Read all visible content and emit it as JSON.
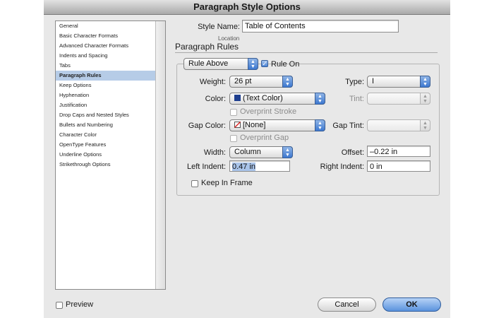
{
  "window": {
    "title": "Paragraph Style Options"
  },
  "sidebar": {
    "items": [
      {
        "label": "General"
      },
      {
        "label": "Basic Character Formats"
      },
      {
        "label": "Advanced Character Formats"
      },
      {
        "label": "Indents and Spacing"
      },
      {
        "label": "Tabs"
      },
      {
        "label": "Paragraph Rules"
      },
      {
        "label": "Keep Options"
      },
      {
        "label": "Hyphenation"
      },
      {
        "label": "Justification"
      },
      {
        "label": "Drop Caps and Nested Styles"
      },
      {
        "label": "Bullets and Numbering"
      },
      {
        "label": "Character Color"
      },
      {
        "label": "OpenType Features"
      },
      {
        "label": "Underline Options"
      },
      {
        "label": "Strikethrough Options"
      }
    ],
    "selected": "Paragraph Rules"
  },
  "header": {
    "style_name_label": "Style Name:",
    "style_name_value": "Table of Contents",
    "location_label": "Location",
    "section_title": "Paragraph Rules"
  },
  "rules": {
    "rule_select": "Rule Above",
    "rule_on_label": "Rule On",
    "rule_on_checked": true,
    "weight_label": "Weight:",
    "weight_value": "26 pt",
    "type_label": "Type:",
    "type_value": "I",
    "color_label": "Color:",
    "color_value": "(Text Color)",
    "color_swatch": "#1f3f8f",
    "tint_label": "Tint:",
    "tint_value": "",
    "overprint_stroke_label": "Overprint Stroke",
    "gap_color_label": "Gap Color:",
    "gap_color_value": "[None]",
    "gap_swatch_icon": "none-swatch-icon",
    "gap_tint_label": "Gap Tint:",
    "gap_tint_value": "",
    "overprint_gap_label": "Overprint Gap",
    "width_label": "Width:",
    "width_value": "Column",
    "offset_label": "Offset:",
    "offset_value": "–0.22 in",
    "left_indent_label": "Left Indent:",
    "left_indent_value": "0.47 in",
    "right_indent_label": "Right Indent:",
    "right_indent_value": "0 in",
    "keep_in_frame_label": "Keep In Frame",
    "keep_in_frame_checked": false
  },
  "footer": {
    "preview_label": "Preview",
    "cancel_label": "Cancel",
    "ok_label": "OK"
  },
  "colors": {
    "accent": "#4a82d3",
    "selection": "#b6cce7"
  }
}
